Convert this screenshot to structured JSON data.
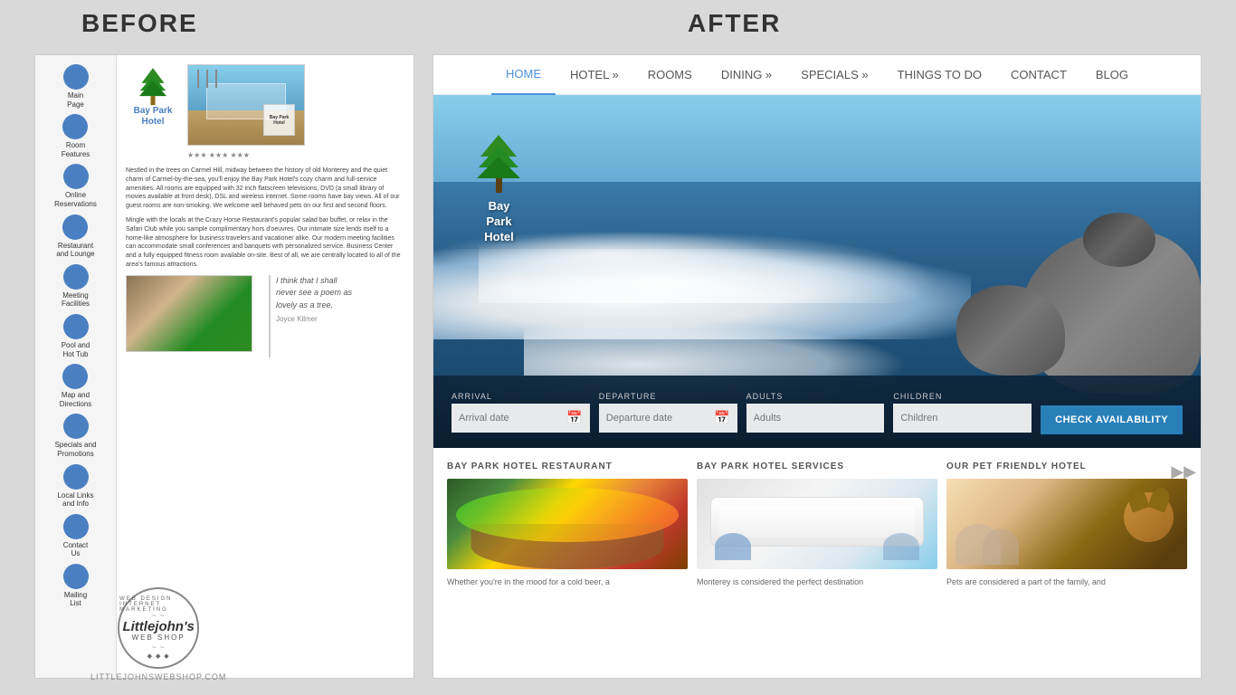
{
  "labels": {
    "before": "BEFORE",
    "after": "AFTER"
  },
  "before": {
    "nav_items": [
      {
        "label": "Main\nPage"
      },
      {
        "label": "Room\nFeatures"
      },
      {
        "label": "Online\nReservations"
      },
      {
        "label": "Restaurant\nand Lounge"
      },
      {
        "label": "Meeting\nFacilities"
      },
      {
        "label": "Pool and\nHot Tub"
      },
      {
        "label": "Map and\nDirections"
      },
      {
        "label": "Specials and\nPromotions"
      },
      {
        "label": "Local Links\nand Info"
      },
      {
        "label": "Contact\nUs"
      },
      {
        "label": "Mailing\nList"
      }
    ],
    "hotel_name": "Bay\nPark\nHotel",
    "stars": "★★★ ★★★ ★★★",
    "body_text": "Nestled in the trees on Carmel Hill, midway between the history of old Monterey and the quiet charm of Carmel-by-the-sea, you'll enjoy the Bay Park Hotel's cozy charm and full-service amenities. All rooms are equipped with 32 inch flatscreen televisions, DVD (a small library of movies available at front desk), DSL and wireless internet. Some rooms have bay views. All of our guest rooms are non-smoking. We welcome well behaved pets on our first and second floors.",
    "body_text2": "Mingle with the locals at the Crazy Horse Restaurant's popular salad bar buffet, or relax in the Safari Club while you sample complimentary hors d'oeuvres. Our intimate size lends itself to a home-like atmosphere for business travelers and vacationer alike. Our modern meeting facilities can accommodate small conferences and banquets with personalized service. Business Center and a fully equipped fitness room available on-site. Best of all, we are centrally located to all of the area's famous attractions.",
    "quote": "I think that I shall\nnever see a poem as\nlovely as a tree.",
    "quote_author": "Joyce Kilmer"
  },
  "after": {
    "nav": {
      "items": [
        {
          "label": "HOME",
          "active": true
        },
        {
          "label": "HOTEL »",
          "active": false
        },
        {
          "label": "ROOMS",
          "active": false
        },
        {
          "label": "DINING »",
          "active": false
        },
        {
          "label": "SPECIALS »",
          "active": false
        },
        {
          "label": "THINGS TO DO",
          "active": false
        },
        {
          "label": "CONTACT",
          "active": false
        },
        {
          "label": "BLOG",
          "active": false
        }
      ]
    },
    "hotel_name": "Bay\nPark\nHotel",
    "booking": {
      "arrival_label": "ARRIVAL",
      "departure_label": "DEPARTURE",
      "adults_label": "ADULTS",
      "children_label": "CHILDREN",
      "arrival_placeholder": "Arrival date",
      "departure_placeholder": "Departure date",
      "adults_placeholder": "Adults",
      "children_placeholder": "Children",
      "button_label": "CHECK AVAILABILITY"
    },
    "sections": [
      {
        "title": "BAY PARK HOTEL RESTAURANT",
        "text": "Whether you're in the mood for a cold beer, a"
      },
      {
        "title": "BAY PARK HOTEL SERVICES",
        "text": "Monterey is considered the perfect destination"
      },
      {
        "title": "OUR PET FRIENDLY HOTEL",
        "text": "Pets are considered a part of the family, and"
      }
    ]
  },
  "watermark": {
    "circle_text_top": "WEB DESIGN · INTERNET MARKETING",
    "name": "Littlejohn's",
    "subtitle": "WEB SHOP",
    "url": "LITTLEJOHNSWEBSHOP.COM"
  }
}
